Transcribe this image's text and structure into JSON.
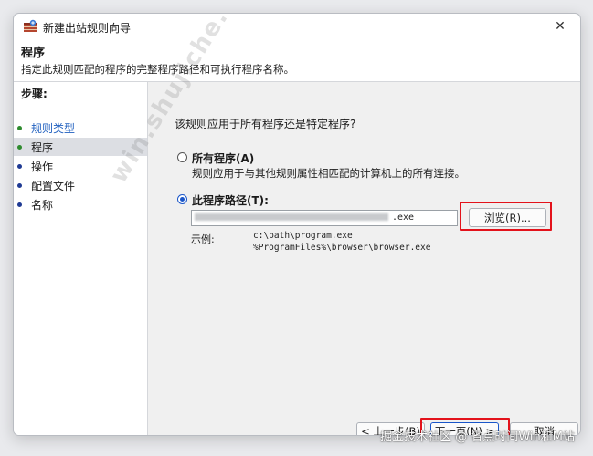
{
  "window": {
    "title": "新建出站规则向导",
    "close_glyph": "✕"
  },
  "header": {
    "title": "程序",
    "subtitle": "指定此规则匹配的程序的完整程序路径和可执行程序名称。"
  },
  "sidebar": {
    "title": "步骤:",
    "items": [
      {
        "label": "规则类型"
      },
      {
        "label": "程序"
      },
      {
        "label": "操作"
      },
      {
        "label": "配置文件"
      },
      {
        "label": "名称"
      }
    ]
  },
  "main": {
    "question": "该规则应用于所有程序还是特定程序?",
    "option_all": {
      "label": "所有程序(A)",
      "description": "规则应用于与其他规则属性相匹配的计算机上的所有连接。"
    },
    "option_path": {
      "label": "此程序路径(T):",
      "value_suffix": ".exe"
    },
    "browse_label": "浏览(R)...",
    "example_label": "示例:",
    "example_lines": [
      "c:\\path\\program.exe",
      "%ProgramFiles%\\browser\\browser.exe"
    ]
  },
  "footer": {
    "back_label": "< 上一步(B)",
    "next_label": "下一页(N) >",
    "cancel_label": "取消"
  },
  "watermarks": {
    "diagonal": "win.shujiche.cc",
    "bottom": "掘金技术社区 @ 省点时间Win和M站"
  },
  "colors": {
    "accent": "#1a56c9",
    "highlight": "#e3121b",
    "step_done": "#2e8b2e",
    "step_todo": "#1f3a93"
  }
}
